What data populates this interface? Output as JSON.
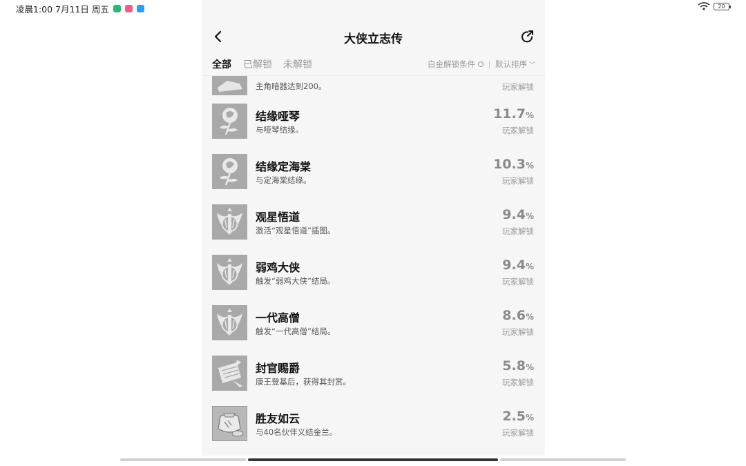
{
  "status": {
    "time": "凌晨1:00 7月11日 周五",
    "battery": "20"
  },
  "nav": {
    "title": "大侠立志传"
  },
  "tabs": [
    {
      "label": "全部"
    },
    {
      "label": "已解锁"
    },
    {
      "label": "未解锁"
    }
  ],
  "filters": {
    "platinum": "白金解锁条件",
    "sort": "默认排序"
  },
  "achievements": [
    {
      "name": "",
      "desc": "主角暗器达到200。",
      "pct": "",
      "unit": "",
      "sub": "玩家解锁",
      "icon": "hand-icon"
    },
    {
      "name": "结缘哑琴",
      "desc": "与哑琴结缘。",
      "pct": "11.7",
      "unit": "%",
      "sub": "玩家解锁",
      "icon": "rose-icon"
    },
    {
      "name": "结缘定海棠",
      "desc": "与定海棠结缘。",
      "pct": "10.3",
      "unit": "%",
      "sub": "玩家解锁",
      "icon": "rose-icon"
    },
    {
      "name": "观星悟道",
      "desc": "激活“观星悟道”插图。",
      "pct": "9.4",
      "unit": "%",
      "sub": "玩家解锁",
      "icon": "emblem-icon"
    },
    {
      "name": "弱鸡大侠",
      "desc": "触发“弱鸡大侠”结局。",
      "pct": "9.4",
      "unit": "%",
      "sub": "玩家解锁",
      "icon": "emblem-icon"
    },
    {
      "name": "一代高僧",
      "desc": "触发“一代高僧”结局。",
      "pct": "8.6",
      "unit": "%",
      "sub": "玩家解锁",
      "icon": "emblem-icon"
    },
    {
      "name": "封官赐爵",
      "desc": "康王登基后，获得其封赏。",
      "pct": "5.8",
      "unit": "%",
      "sub": "玩家解锁",
      "icon": "scroll-icon"
    },
    {
      "name": "胜友如云",
      "desc": "与40名伙伴义结金兰。",
      "pct": "2.5",
      "unit": "%",
      "sub": "玩家解锁",
      "icon": "pot-icon"
    }
  ],
  "colors": {
    "panel_bg": "#f6f6f7",
    "icon_bg": "#a9a9a9",
    "pct": "#8a8a8a"
  }
}
